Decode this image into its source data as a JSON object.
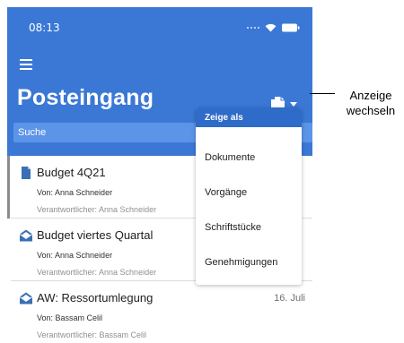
{
  "status_bar": {
    "time": "08:13",
    "icons": [
      "signal-dots-icon",
      "wifi-icon",
      "battery-icon"
    ]
  },
  "header": {
    "menu_icon": "hamburger-menu-icon",
    "title": "Posteingang",
    "view_toggle_icon": "documents-icon"
  },
  "search": {
    "placeholder": "Suche"
  },
  "messages": [
    {
      "icon": "document-icon",
      "title": "Budget 4Q21",
      "from": "Von: Anna Schneider",
      "responsible": "Verantwortlicher: Anna Schneider",
      "date": "",
      "selected": true
    },
    {
      "icon": "open-envelope-icon",
      "title": "Budget viertes Quartal",
      "from": "Von: Anna Schneider",
      "responsible": "Verantwortlicher: Anna Schneider",
      "date": "",
      "selected": false
    },
    {
      "icon": "open-envelope-icon",
      "title": "AW: Ressortumlegung",
      "from": "Von: Bassam Celil",
      "responsible": "Verantwortlicher: Bassam Celil",
      "date": "16. Juli",
      "selected": false
    }
  ],
  "dropdown": {
    "header": "Zeige als",
    "items": [
      "Dokumente",
      "Vorgänge",
      "Schriftstücke",
      "Genehmigungen"
    ]
  },
  "callout": {
    "line1": "Anzeige",
    "line2": "wechseln"
  },
  "colors": {
    "header_blue": "#3b78d6",
    "search_blue": "#5c94e8",
    "dropdown_header_blue": "#2f6bc8",
    "icon_blue": "#3a6fb6"
  }
}
